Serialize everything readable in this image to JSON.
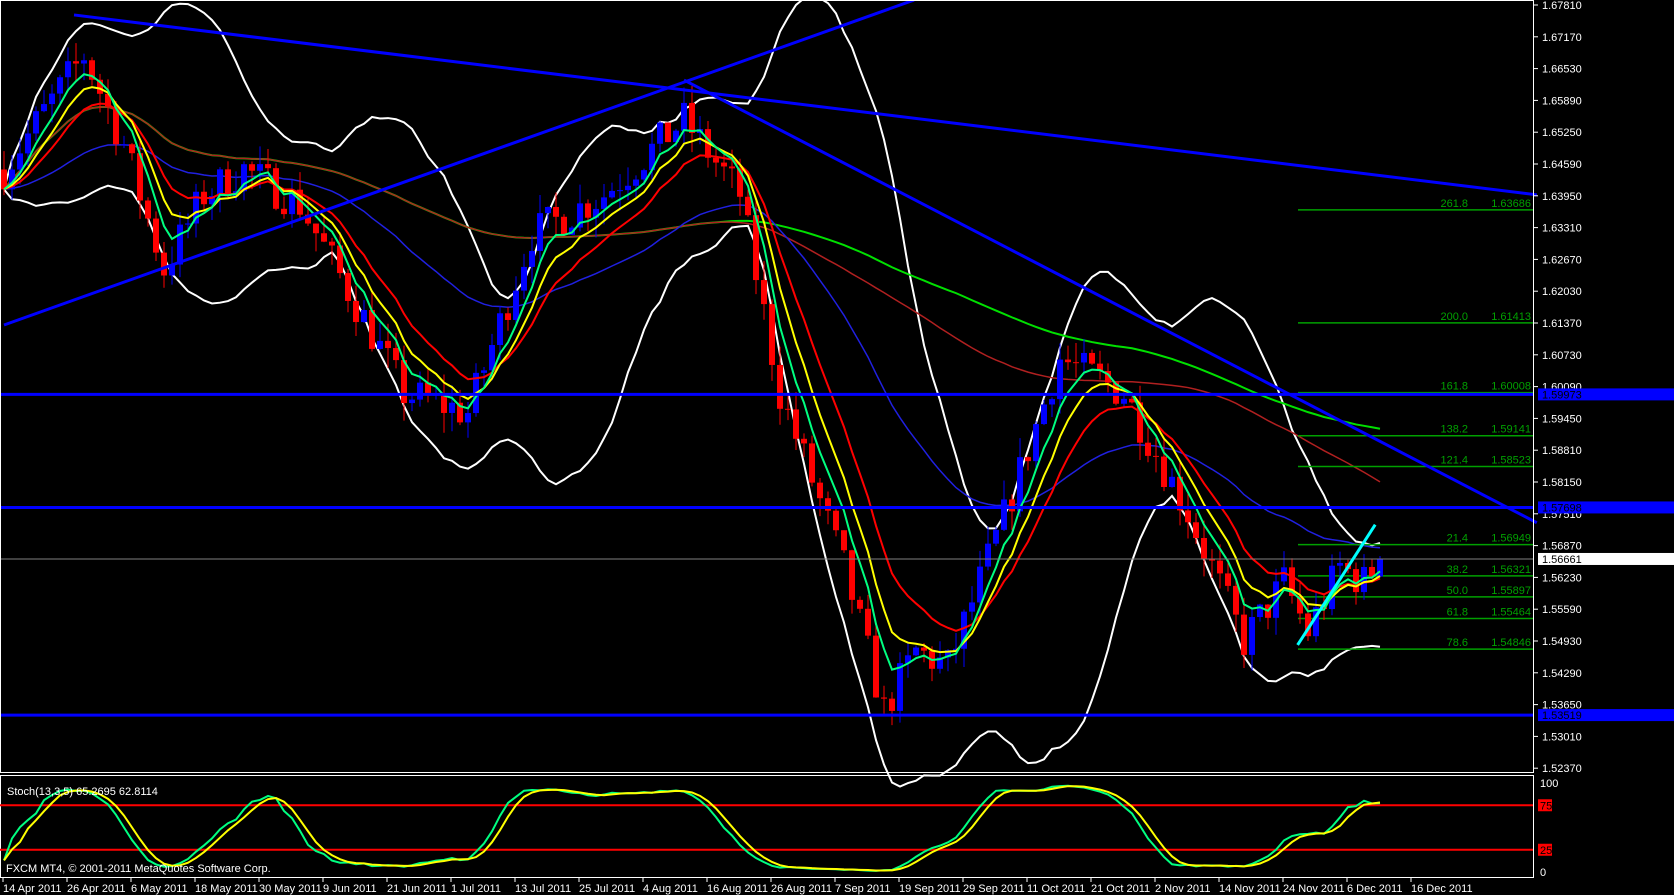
{
  "window": {
    "platform": "FXCM MT4",
    "copyright": "FXCM MT4, © 2001-2011 MetaQuotes Software Corp."
  },
  "colors": {
    "background": "#000000",
    "bull": "#0000ff",
    "bear": "#ff0000",
    "axis": "#ffffff",
    "fib": "#00a000",
    "trend": "#0000ff",
    "cyan": "#00ffff",
    "bands": "#ffffff"
  },
  "price_axis": {
    "labels": [
      "1.67810",
      "1.67170",
      "1.66530",
      "1.65890",
      "1.65250",
      "1.64590",
      "1.63950",
      "1.63310",
      "1.62670",
      "1.62030",
      "1.61370",
      "1.60730",
      "1.60090",
      "1.59450",
      "1.58810",
      "1.58150",
      "1.57510",
      "1.56870",
      "1.56230",
      "1.55590",
      "1.54930",
      "1.54290",
      "1.53650",
      "1.53010",
      "1.52370"
    ],
    "top": 1.6781,
    "step": 0.0064,
    "markers": [
      {
        "label": "1.59973",
        "price": 1.59973,
        "kind": "blue"
      },
      {
        "label": "1.57698",
        "price": 1.57698,
        "kind": "blue"
      },
      {
        "label": "1.53519",
        "price": 1.53519,
        "kind": "blue"
      },
      {
        "label": "1.56661",
        "price": 1.56661,
        "kind": "current"
      }
    ]
  },
  "fib_levels": [
    {
      "level": "261.8",
      "value": "1.63686",
      "price": 1.63686
    },
    {
      "level": "200.0",
      "value": "1.61413",
      "price": 1.61413
    },
    {
      "level": "161.8",
      "value": "1.60008",
      "price": 1.60008
    },
    {
      "level": "138.2",
      "value": "1.59141",
      "price": 1.59141
    },
    {
      "level": "121.4",
      "value": "1.58523",
      "price": 1.58523
    },
    {
      "level": "21.4",
      "value": "1.56949",
      "price": 1.56949
    },
    {
      "level": "38.2",
      "value": "1.56321",
      "price": 1.56321
    },
    {
      "level": "50.0",
      "value": "1.55897",
      "price": 1.55897
    },
    {
      "level": "61.8",
      "value": "1.55464",
      "price": 1.55464
    },
    {
      "level": "78.6",
      "value": "1.54846",
      "price": 1.54846
    }
  ],
  "trendlines": [
    {
      "b1": 8.75,
      "p1": 1.6761,
      "b2": 191.6,
      "p2": 1.6399,
      "color": "#0000ff"
    },
    {
      "b1": 0,
      "p1": 1.6137,
      "b2": 113.75,
      "p2": 1.6791,
      "color": "#0000ff"
    },
    {
      "b1": 85,
      "p1": 1.663,
      "b2": 191.6,
      "p2": 1.5739,
      "color": "#0000ff"
    },
    {
      "b1": 161.7,
      "p1": 1.5493,
      "b2": 171.4,
      "p2": 1.5735,
      "color": "#00ffff"
    }
  ],
  "price_path": [
    [
      0,
      1.645
    ],
    [
      10,
      1.668
    ],
    [
      15,
      1.65
    ],
    [
      20,
      1.625
    ],
    [
      25,
      1.64
    ],
    [
      30,
      1.645
    ],
    [
      37,
      1.638
    ],
    [
      45,
      1.615
    ],
    [
      50,
      1.6
    ],
    [
      58,
      1.596
    ],
    [
      66,
      1.632
    ],
    [
      75,
      1.64
    ],
    [
      85,
      1.655
    ],
    [
      92,
      1.64
    ],
    [
      97,
      1.6
    ],
    [
      105,
      1.565
    ],
    [
      110,
      1.536
    ],
    [
      114,
      1.548
    ],
    [
      118,
      1.545
    ],
    [
      125,
      1.575
    ],
    [
      132,
      1.607
    ],
    [
      140,
      1.6
    ],
    [
      148,
      1.576
    ],
    [
      155,
      1.55
    ],
    [
      160,
      1.562
    ],
    [
      163,
      1.552
    ],
    [
      167,
      1.565
    ],
    [
      170,
      1.562
    ],
    [
      172,
      1.5666
    ]
  ],
  "time_axis": {
    "labels": [
      "14 Apr 2011",
      "26 Apr 2011",
      "6 May 2011",
      "18 May 2011",
      "30 May 2011",
      "9 Jun 2011",
      "21 Jun 2011",
      "1 Jul 2011",
      "13 Jul 2011",
      "25 Jul 2011",
      "4 Aug 2011",
      "16 Aug 2011",
      "26 Aug 2011",
      "7 Sep 2011",
      "19 Sep 2011",
      "29 Sep 2011",
      "11 Oct 2011",
      "21 Oct 2011",
      "2 Nov 2011",
      "14 Nov 2011",
      "24 Nov 2011",
      "6 Dec 2011",
      "16 Dec 2011"
    ]
  },
  "stochastic": {
    "header": "Stoch(13,3,5) 65.2695 62.8114",
    "levels": [
      "100",
      "75",
      "25",
      "0"
    ]
  }
}
